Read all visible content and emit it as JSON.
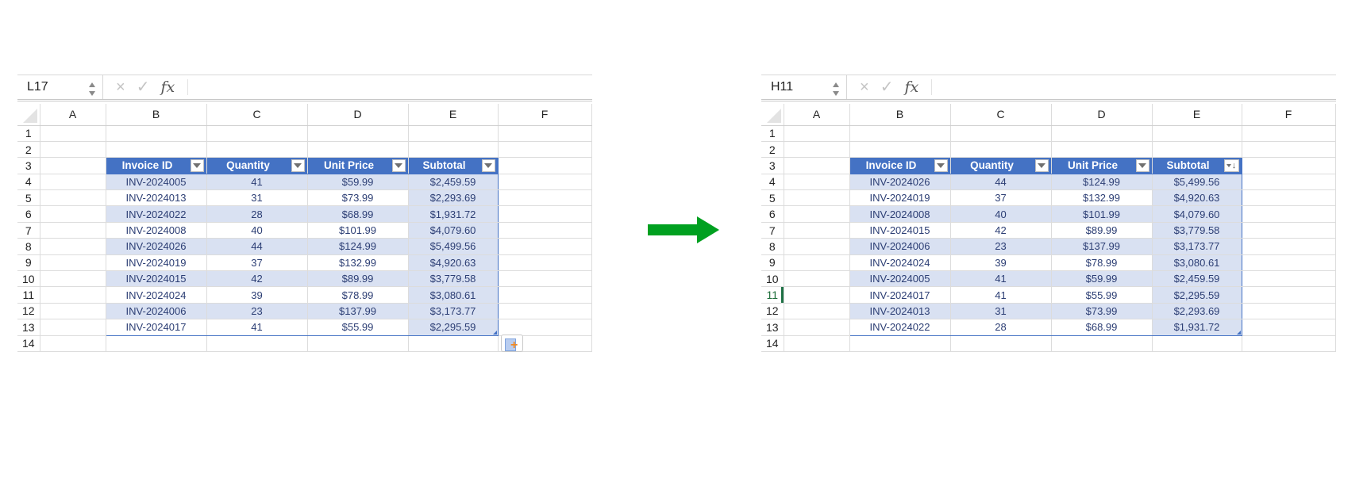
{
  "colors": {
    "table_header": "#4472c4",
    "table_band": "#d9e1f2",
    "table_text": "#2c3e74",
    "arrow": "#00a020",
    "active_row": "#1e7145"
  },
  "formula_bar": {
    "cancel_icon": "×",
    "enter_icon": "✓",
    "fx_label": "fx"
  },
  "column_letters": [
    "A",
    "B",
    "C",
    "D",
    "E",
    "F"
  ],
  "row_numbers": [
    "1",
    "2",
    "3",
    "4",
    "5",
    "6",
    "7",
    "8",
    "9",
    "10",
    "11",
    "12",
    "13",
    "14"
  ],
  "table_headers": [
    "Invoice ID",
    "Quantity",
    "Unit Price",
    "Subtotal"
  ],
  "before": {
    "name_box": "L17",
    "formula": "",
    "rows": [
      [
        "INV-2024005",
        "41",
        "$59.99",
        "$2,459.59"
      ],
      [
        "INV-2024013",
        "31",
        "$73.99",
        "$2,293.69"
      ],
      [
        "INV-2024022",
        "28",
        "$68.99",
        "$1,931.72"
      ],
      [
        "INV-2024008",
        "40",
        "$101.99",
        "$4,079.60"
      ],
      [
        "INV-2024026",
        "44",
        "$124.99",
        "$5,499.56"
      ],
      [
        "INV-2024019",
        "37",
        "$132.99",
        "$4,920.63"
      ],
      [
        "INV-2024015",
        "42",
        "$89.99",
        "$3,779.58"
      ],
      [
        "INV-2024024",
        "39",
        "$78.99",
        "$3,080.61"
      ],
      [
        "INV-2024006",
        "23",
        "$137.99",
        "$3,173.77"
      ],
      [
        "INV-2024017",
        "41",
        "$55.99",
        "$2,295.59"
      ]
    ],
    "paste_options_icon": "paste-options"
  },
  "after": {
    "name_box": "H11",
    "formula": "",
    "active_row": "11",
    "sorted_column": "Subtotal",
    "sort_order": "descending",
    "sort_indicator": "↓",
    "rows": [
      [
        "INV-2024026",
        "44",
        "$124.99",
        "$5,499.56"
      ],
      [
        "INV-2024019",
        "37",
        "$132.99",
        "$4,920.63"
      ],
      [
        "INV-2024008",
        "40",
        "$101.99",
        "$4,079.60"
      ],
      [
        "INV-2024015",
        "42",
        "$89.99",
        "$3,779.58"
      ],
      [
        "INV-2024006",
        "23",
        "$137.99",
        "$3,173.77"
      ],
      [
        "INV-2024024",
        "39",
        "$78.99",
        "$3,080.61"
      ],
      [
        "INV-2024005",
        "41",
        "$59.99",
        "$2,459.59"
      ],
      [
        "INV-2024017",
        "41",
        "$55.99",
        "$2,295.59"
      ],
      [
        "INV-2024013",
        "31",
        "$73.99",
        "$2,293.69"
      ],
      [
        "INV-2024022",
        "28",
        "$68.99",
        "$1,931.72"
      ]
    ]
  },
  "transition_arrow": "right-arrow"
}
